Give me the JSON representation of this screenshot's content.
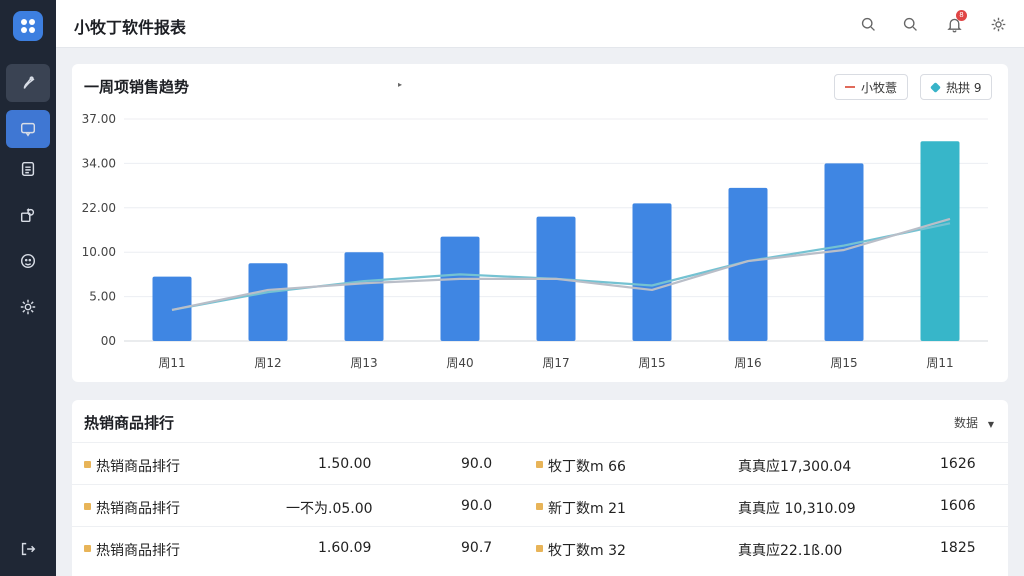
{
  "header": {
    "title": "小牧丁软件报表",
    "icons": [
      "search-icon",
      "search-icon",
      "bell-icon",
      "gear-icon"
    ],
    "notification_count": "8"
  },
  "sidebar": {
    "items": [
      {
        "name": "brush-icon"
      },
      {
        "name": "chat-icon"
      },
      {
        "name": "document-icon"
      },
      {
        "name": "layers-icon"
      },
      {
        "name": "face-icon"
      },
      {
        "name": "gear-icon"
      }
    ],
    "bottom": {
      "name": "logout-icon"
    }
  },
  "chart_card": {
    "title": "一周项销售趋势",
    "legend": [
      {
        "label": "小牧薏",
        "color": "#e06a5a"
      },
      {
        "label": "热拱 9",
        "color": "#38b3c8"
      }
    ]
  },
  "chart_data": {
    "type": "bar",
    "title": "一周项销售趋势",
    "categories": [
      "周11",
      "周12",
      "周13",
      "周40",
      "周17",
      "周15",
      "周16",
      "周15",
      "周11"
    ],
    "y_ticks": [
      "37.00",
      "34.00",
      "22.00",
      "10.00",
      "5.00",
      "00"
    ],
    "ylim_note": "tick labels are non-linear as printed",
    "bar_levels": [
      0.29,
      0.35,
      0.4,
      0.47,
      0.56,
      0.62,
      0.69,
      0.8,
      0.9
    ],
    "bar_colors": [
      "#3f86e3",
      "#3f86e3",
      "#3f86e3",
      "#3f86e3",
      "#3f86e3",
      "#3f86e3",
      "#3f86e3",
      "#3f86e3",
      "#37b6c9"
    ],
    "series": [
      {
        "name": "小牧薏",
        "color": "#b9bec8",
        "levels": [
          0.14,
          0.23,
          0.26,
          0.28,
          0.28,
          0.23,
          0.36,
          0.41,
          0.55
        ]
      },
      {
        "name": "热拱 9",
        "color": "#74c2d2",
        "levels": [
          0.14,
          0.22,
          0.27,
          0.3,
          0.28,
          0.25,
          0.36,
          0.43,
          0.53
        ]
      }
    ],
    "grid": true,
    "legend_position": "top-right"
  },
  "table_card": {
    "title": "热销商品排行",
    "filter_label": "数据",
    "rows": [
      {
        "name": "热销商品排行",
        "value1": "1.50.00",
        "value2": "90.0",
        "dot_color": "#e8b458",
        "product": "牧丁数m 66",
        "amount": "真真应17,300.04",
        "count": "1626"
      },
      {
        "name": "热销商品排行",
        "value1": "一不为.05.00",
        "value2": "90.0",
        "dot_color": "#e8b458",
        "product": "新丁数m 21",
        "amount": "真真应 10,310.09",
        "count": "1606"
      },
      {
        "name": "热销商品排行",
        "value1": "1.60.09",
        "value2": "90.7",
        "dot_color": "#e8b458",
        "product": "牧丁数m 32",
        "amount": "真真应22.1ß.00",
        "count": "1825"
      }
    ]
  }
}
